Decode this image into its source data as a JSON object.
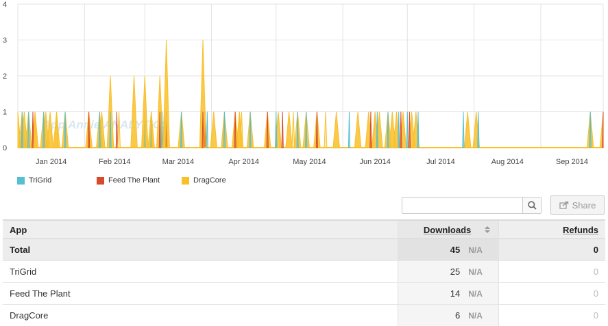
{
  "chart_data": {
    "type": "area",
    "x_range": [
      "2014-01-01",
      "2014-09-30"
    ],
    "yticks": [
      "0",
      "1",
      "2",
      "3",
      "4"
    ],
    "ylim": [
      0,
      4
    ],
    "xticks": [
      "Jan 2014",
      "Feb 2014",
      "Mar 2014",
      "Apr 2014",
      "May 2014",
      "Jun 2014",
      "Jul 2014",
      "Aug 2014",
      "Sep 2014"
    ],
    "grid": true,
    "watermark": "App Annie ANALYTICS",
    "series": [
      {
        "name": "TriGrid",
        "color": "#55c0d2",
        "points": [
          [
            "2014-01-03",
            1
          ],
          [
            "2014-01-06",
            1
          ],
          [
            "2014-01-13",
            1
          ],
          [
            "2014-01-23",
            1
          ],
          [
            "2014-02-08",
            1
          ],
          [
            "2014-02-13",
            1
          ],
          [
            "2014-03-01",
            1
          ],
          [
            "2014-03-04",
            1
          ],
          [
            "2014-03-09",
            1
          ],
          [
            "2014-03-18",
            1
          ],
          [
            "2014-03-30",
            1
          ],
          [
            "2014-04-07",
            1
          ],
          [
            "2014-04-19",
            1
          ],
          [
            "2014-05-01",
            1
          ],
          [
            "2014-05-11",
            1
          ],
          [
            "2014-05-15",
            1
          ],
          [
            "2014-06-04",
            1
          ],
          [
            "2014-06-17",
            1
          ],
          [
            "2014-06-22",
            1
          ],
          [
            "2014-06-27",
            1
          ],
          [
            "2014-07-01",
            1
          ],
          [
            "2014-07-06",
            1
          ],
          [
            "2014-07-27",
            1
          ],
          [
            "2014-08-03",
            1
          ],
          [
            "2014-09-24",
            1
          ]
        ]
      },
      {
        "name": "Feed The Plant",
        "color": "#d84a2c",
        "points": [
          [
            "2014-01-08",
            1
          ],
          [
            "2014-02-03",
            1
          ],
          [
            "2014-02-16",
            1
          ],
          [
            "2014-03-08",
            1
          ],
          [
            "2014-03-11",
            1
          ],
          [
            "2014-03-28",
            1
          ],
          [
            "2014-03-29",
            1
          ],
          [
            "2014-04-12",
            1
          ],
          [
            "2014-04-27",
            1
          ],
          [
            "2014-05-04",
            1
          ],
          [
            "2014-05-20",
            1
          ],
          [
            "2014-06-14",
            1
          ],
          [
            "2014-06-28",
            1
          ],
          [
            "2014-07-02",
            1
          ],
          [
            "2014-09-30",
            1
          ]
        ]
      },
      {
        "name": "DragCore",
        "color": "#f9c02a",
        "points": [
          [
            "2014-01-09",
            1
          ],
          [
            "2014-01-19",
            1
          ],
          [
            "2014-02-17",
            1
          ],
          [
            "2014-03-01",
            1
          ],
          [
            "2014-03-04",
            1
          ],
          [
            "2014-03-10",
            1
          ],
          [
            "2014-03-11",
            1
          ],
          [
            "2014-03-29",
            1
          ],
          [
            "2014-04-14",
            1
          ],
          [
            "2014-04-15",
            1
          ],
          [
            "2014-05-09",
            1
          ],
          [
            "2014-05-24",
            1
          ]
        ]
      }
    ],
    "total_points": [
      [
        "2014-01-01",
        1
      ],
      [
        "2014-01-03",
        1
      ],
      [
        "2014-01-04",
        1
      ],
      [
        "2014-01-06",
        1
      ],
      [
        "2014-01-09",
        1
      ],
      [
        "2014-01-13",
        1
      ],
      [
        "2014-01-14",
        1
      ],
      [
        "2014-01-16",
        1
      ],
      [
        "2014-01-19",
        1
      ],
      [
        "2014-01-23",
        1
      ],
      [
        "2014-02-03",
        1
      ],
      [
        "2014-02-08",
        1
      ],
      [
        "2014-02-09",
        1
      ],
      [
        "2014-02-13",
        2
      ],
      [
        "2014-02-24",
        2
      ],
      [
        "2014-03-01",
        2
      ],
      [
        "2014-03-04",
        1
      ],
      [
        "2014-03-08",
        2
      ],
      [
        "2014-03-11",
        3
      ],
      [
        "2014-03-18",
        1
      ],
      [
        "2014-03-28",
        3
      ],
      [
        "2014-04-02",
        1
      ],
      [
        "2014-04-07",
        1
      ],
      [
        "2014-04-12",
        1
      ],
      [
        "2014-04-14",
        1
      ],
      [
        "2014-04-19",
        1
      ],
      [
        "2014-04-27",
        1
      ],
      [
        "2014-05-02",
        1
      ],
      [
        "2014-05-07",
        1
      ],
      [
        "2014-05-11",
        1
      ],
      [
        "2014-05-15",
        1
      ],
      [
        "2014-05-20",
        1
      ],
      [
        "2014-05-29",
        1
      ],
      [
        "2014-06-08",
        1
      ],
      [
        "2014-06-13",
        1
      ],
      [
        "2014-06-16",
        1
      ],
      [
        "2014-06-18",
        1
      ],
      [
        "2014-06-22",
        1
      ],
      [
        "2014-06-24",
        1
      ],
      [
        "2014-06-26",
        1
      ],
      [
        "2014-06-29",
        1
      ],
      [
        "2014-07-03",
        1
      ],
      [
        "2014-07-05",
        1
      ],
      [
        "2014-07-29",
        1
      ],
      [
        "2014-08-02",
        1
      ],
      [
        "2014-09-24",
        1
      ],
      [
        "2014-09-30",
        1
      ]
    ]
  },
  "legend": [
    {
      "label": "TriGrid",
      "color": "#55c0d2"
    },
    {
      "label": "Feed The Plant",
      "color": "#d84a2c"
    },
    {
      "label": "DragCore",
      "color": "#f9c02a"
    }
  ],
  "search": {
    "placeholder": "",
    "value": ""
  },
  "share_label": "Share",
  "table": {
    "headers": {
      "app": "App",
      "downloads": "Downloads",
      "refunds": "Refunds"
    },
    "total": {
      "app": "Total",
      "downloads": "45",
      "downloads_change": "N/A",
      "refunds": "0"
    },
    "rows": [
      {
        "app": "TriGrid",
        "downloads": "25",
        "downloads_change": "N/A",
        "refunds": "0"
      },
      {
        "app": "Feed The Plant",
        "downloads": "14",
        "downloads_change": "N/A",
        "refunds": "0"
      },
      {
        "app": "DragCore",
        "downloads": "6",
        "downloads_change": "N/A",
        "refunds": "0"
      }
    ]
  }
}
